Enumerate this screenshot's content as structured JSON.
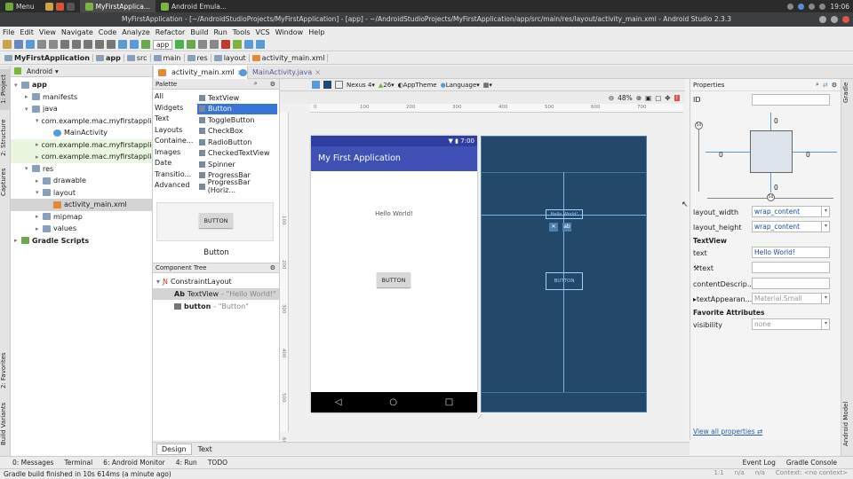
{
  "taskbar": {
    "menu": "Menu",
    "tasks": [
      "MyFirstApplica...",
      "Android Emula..."
    ],
    "clock": "19:06"
  },
  "window": {
    "title": "MyFirstApplication - [~/AndroidStudioProjects/MyFirstApplication] - [app] - ~/AndroidStudioProjects/MyFirstApplication/app/src/main/res/layout/activity_main.xml - Android Studio 2.3.3"
  },
  "menubar": [
    "File",
    "Edit",
    "View",
    "Navigate",
    "Code",
    "Analyze",
    "Refactor",
    "Build",
    "Run",
    "Tools",
    "VCS",
    "Window",
    "Help"
  ],
  "toolbar": {
    "module": "app"
  },
  "breadcrumb": [
    "MyFirstApplication",
    "app",
    "src",
    "main",
    "res",
    "layout",
    "activity_main.xml"
  ],
  "leftstrip": [
    "1: Project",
    "2: Structure",
    "Captures",
    "2: Favorites",
    "Build Variants"
  ],
  "project": {
    "view": "Android",
    "tree": [
      {
        "label": "app",
        "indent": 0,
        "arrow": "▾",
        "icon": "folder"
      },
      {
        "label": "manifests",
        "indent": 1,
        "arrow": "▸",
        "icon": "folder"
      },
      {
        "label": "java",
        "indent": 1,
        "arrow": "▾",
        "icon": "folder"
      },
      {
        "label": "com.example.mac.myfirstapplication",
        "indent": 2,
        "arrow": "▾",
        "icon": "package"
      },
      {
        "label": "MainActivity",
        "indent": 3,
        "arrow": "",
        "icon": "class"
      },
      {
        "label": "com.example.mac.myfirstapplication",
        "indent": 2,
        "arrow": "▸",
        "icon": "package",
        "hl": true
      },
      {
        "label": "com.example.mac.myfirstapplication",
        "indent": 2,
        "arrow": "▸",
        "icon": "package",
        "hl": true
      },
      {
        "label": "res",
        "indent": 1,
        "arrow": "▾",
        "icon": "folder"
      },
      {
        "label": "drawable",
        "indent": 2,
        "arrow": "▸",
        "icon": "folder"
      },
      {
        "label": "layout",
        "indent": 2,
        "arrow": "▾",
        "icon": "folder"
      },
      {
        "label": "activity_main.xml",
        "indent": 3,
        "arrow": "",
        "icon": "xml",
        "sel": true
      },
      {
        "label": "mipmap",
        "indent": 2,
        "arrow": "▸",
        "icon": "folder"
      },
      {
        "label": "values",
        "indent": 2,
        "arrow": "▸",
        "icon": "folder"
      },
      {
        "label": "Gradle Scripts",
        "indent": 0,
        "arrow": "▸",
        "icon": "gradle"
      }
    ]
  },
  "editor_tabs": [
    {
      "label": "activity_main.xml",
      "active": true
    },
    {
      "label": "MainActivity.java",
      "active": false
    }
  ],
  "palette": {
    "title": "Palette",
    "categories": [
      "All",
      "Widgets",
      "Text",
      "Layouts",
      "Containe...",
      "Images",
      "Date",
      "Transitio...",
      "Advanced"
    ],
    "items": [
      "TextView",
      "Button",
      "ToggleButton",
      "CheckBox",
      "RadioButton",
      "CheckedTextView",
      "Spinner",
      "ProgressBar",
      "ProgressBar (Horiz..."
    ],
    "selected_index": 1,
    "preview_button": "BUTTON",
    "preview_label": "Button"
  },
  "component_tree": {
    "title": "Component Tree",
    "root": "ConstraintLayout",
    "children": [
      {
        "name": "TextView",
        "value": "- \"Hello World!\""
      },
      {
        "name": "button",
        "value": "- \"Button\""
      }
    ]
  },
  "design_toolbar": {
    "device": "Nexus 4",
    "api": "26",
    "theme": "AppTheme",
    "language": "Language",
    "zoom": "48%"
  },
  "ruler": {
    "top": [
      "0",
      "100",
      "200",
      "300",
      "400",
      "500",
      "600",
      "700"
    ],
    "left": [
      "100",
      "200",
      "300",
      "400",
      "500",
      "600"
    ]
  },
  "phone": {
    "status_time": "7:00",
    "app_title": "My First Application",
    "hello": "Hello World!",
    "button": "BUTTON"
  },
  "blueprint": {
    "text": "Hello World!",
    "button": "BUTTON"
  },
  "properties": {
    "title": "Properties",
    "id_label": "ID",
    "margins": {
      "top": "0",
      "left": "0",
      "right": "0",
      "bottom": "0",
      "bias": "50"
    },
    "layout_width": {
      "label": "layout_width",
      "value": "wrap_content"
    },
    "layout_height": {
      "label": "layout_height",
      "value": "wrap_content"
    },
    "section": "TextView",
    "text": {
      "label": "text",
      "value": "Hello World!"
    },
    "tools_text": {
      "label": "text",
      "value": ""
    },
    "contentDescription": {
      "label": "contentDescrip...",
      "value": ""
    },
    "textAppearance": {
      "label": "textAppearan...",
      "value": "Material.Small"
    },
    "favorites": "Favorite Attributes",
    "visibility": {
      "label": "visibility",
      "value": "none"
    },
    "view_all": "View all properties"
  },
  "rightstrip": [
    "Gradle",
    "Android Model"
  ],
  "bottom_tabs": [
    {
      "label": "Design",
      "active": true
    },
    {
      "label": "Text",
      "active": false
    }
  ],
  "toolwindows": [
    "0: Messages",
    "Terminal",
    "6: Android Monitor",
    "4: Run",
    "TODO"
  ],
  "toolwindows_right": [
    "Event Log",
    "Gradle Console"
  ],
  "status": {
    "message": "Gradle build finished in 10s 614ms (a minute ago)",
    "position": "1:1",
    "na": "n/a",
    "context": "Context: <no context>"
  }
}
